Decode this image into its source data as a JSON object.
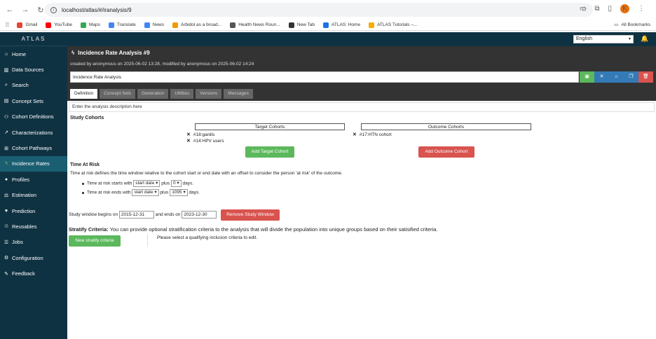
{
  "browser": {
    "url": "localhost/atlas/#/iranalysis/9",
    "profile_initial": "K",
    "bookmarks": [
      {
        "label": "Gmail",
        "color": "#ea4335"
      },
      {
        "label": "YouTube",
        "color": "#ff0000"
      },
      {
        "label": "Maps",
        "color": "#34a853"
      },
      {
        "label": "Translate",
        "color": "#4285f4"
      },
      {
        "label": "News",
        "color": "#4285f4"
      },
      {
        "label": "Arbidol as a broad...",
        "color": "#f29900"
      },
      {
        "label": "Health News Roun...",
        "color": "#555555"
      },
      {
        "label": "New Tab",
        "color": "#333333"
      },
      {
        "label": "ATLAS: Home",
        "color": "#1a73e8"
      },
      {
        "label": "ATLAS Tutorials –...",
        "color": "#f9ab00"
      }
    ],
    "all_bookmarks": "All Bookmarks"
  },
  "app": {
    "brand": "ATLAS",
    "language": "English",
    "nav": [
      {
        "label": "Home",
        "icon": "home-icon",
        "glyph": "⌂"
      },
      {
        "label": "Data Sources",
        "icon": "chart-icon",
        "glyph": "▥"
      },
      {
        "label": "Search",
        "icon": "search-icon",
        "glyph": "⌕"
      },
      {
        "label": "Concept Sets",
        "icon": "cart-icon",
        "glyph": "▤"
      },
      {
        "label": "Cohort Definitions",
        "icon": "users-icon",
        "glyph": "⚇"
      },
      {
        "label": "Characterizations",
        "icon": "line-chart-icon",
        "glyph": "↗"
      },
      {
        "label": "Cohort Pathways",
        "icon": "sitemap-icon",
        "glyph": "⊞"
      },
      {
        "label": "Incidence Rates",
        "icon": "bolt-icon",
        "glyph": "ϟ",
        "active": true
      },
      {
        "label": "Profiles",
        "icon": "user-icon",
        "glyph": "●"
      },
      {
        "label": "Estimation",
        "icon": "balance-icon",
        "glyph": "⚖"
      },
      {
        "label": "Prediction",
        "icon": "heartbeat-icon",
        "glyph": "♥"
      },
      {
        "label": "Reusables",
        "icon": "recycle-icon",
        "glyph": "♲"
      },
      {
        "label": "Jobs",
        "icon": "list-icon",
        "glyph": "☰"
      },
      {
        "label": "Configuration",
        "icon": "cogs-icon",
        "glyph": "⚙"
      },
      {
        "label": "Feedback",
        "icon": "comment-icon",
        "glyph": "✎"
      }
    ]
  },
  "header": {
    "title": "Incidence Rate Analysis #9",
    "meta": "created by anonymous on 2025-06-02 13:28, modified by anonymous on 2025-06-02 14:24",
    "analysis_name": "Incidence Rate Analysis",
    "tabs": [
      "Definition",
      "Concept Sets",
      "Generation",
      "Utilities",
      "Versions",
      "Messages"
    ],
    "tool_colors": {
      "save": "#5cb85c",
      "close": "#337ab7",
      "tag": "#337ab7",
      "copy": "#337ab7",
      "delete": "#d9534f"
    }
  },
  "definition": {
    "description_placeholder": "Enter the analysis description here",
    "study_cohorts_heading": "Study Cohorts",
    "target_header": "Target Cohorts",
    "outcome_header": "Outcome Cohorts",
    "target_cohorts": [
      "#18:gardis",
      "#14:HPV users"
    ],
    "outcome_cohorts": [
      "#17:HTN cohort"
    ],
    "add_target_label": "Add Target Cohort",
    "add_outcome_label": "Add Outcome Cohort",
    "time_at_risk_heading": "Time At Risk",
    "time_at_risk_desc": "Time at risk defines the time window relative to the cohort start or end date with an offset to consider the person 'at risk' of the outcome.",
    "tar_start": {
      "prefix": "Time at risk starts with",
      "anchor": "start date",
      "plus": "plus",
      "offset": "0",
      "unit": "days."
    },
    "tar_end": {
      "prefix": "Time at risk ends with",
      "anchor": "start date",
      "plus": "plus",
      "offset": "1095",
      "unit": "days."
    },
    "study_window": {
      "begins_label": "Study window begins on",
      "start": "2015-12-31",
      "ends_label": "and ends on",
      "end": "2023-12-30",
      "remove_label": "Remove Study Window"
    },
    "stratify": {
      "heading": "Stratify Criteria:",
      "text": "You can provide optional stratification criteria to the analysis that will divide the population into unique groups based on their satisified criteria.",
      "new_label": "New stratify criteria",
      "hint": "Please select a qualifying inclusion criteria to edit."
    }
  }
}
